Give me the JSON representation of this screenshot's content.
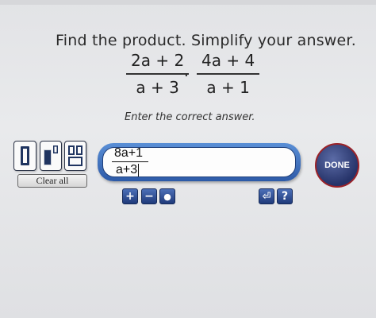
{
  "question": {
    "heading": "Find the product. Simplify your answer.",
    "left_fraction": {
      "numerator": "2a + 2",
      "denominator": "a + 3"
    },
    "operator": "·",
    "right_fraction": {
      "numerator": "4a + 4",
      "denominator": "a + 1"
    }
  },
  "prompt": "Enter the correct answer.",
  "templates": {
    "items": [
      "fraction-template-icon",
      "exponent-template-icon",
      "mixed-number-template-icon"
    ],
    "clear_label": "Clear all"
  },
  "answer": {
    "numerator": "8a+1",
    "denominator": "a+3"
  },
  "done_label": "DONE",
  "tools": {
    "left_symbols": [
      "+",
      "−",
      "●"
    ],
    "right_symbols": [
      "⏎",
      "?"
    ]
  },
  "colors": {
    "button_blue": "#2d5aa8",
    "done_ring": "#9b2228"
  }
}
